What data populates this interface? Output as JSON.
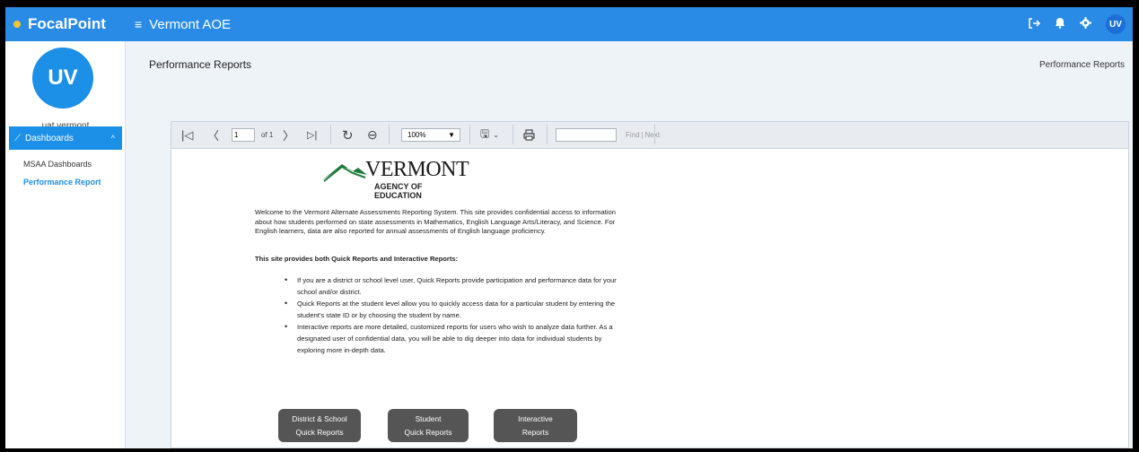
{
  "app": {
    "brand": "FocalPoint",
    "workspace": "Vermont AOE",
    "user_initials": "UV"
  },
  "sidebar": {
    "avatar_initials": "UV",
    "username": "uat vermont",
    "nav": {
      "dashboards": "Dashboards",
      "items": [
        {
          "label": "MSAA Dashboards"
        },
        {
          "label": "Performance Report"
        }
      ]
    }
  },
  "page": {
    "title": "Performance Reports",
    "breadcrumb": "Performance Reports"
  },
  "viewer": {
    "page_number": "1",
    "page_of": "of 1",
    "zoom": "100%",
    "find_placeholder": "",
    "find_label": "Find",
    "next_label": "Next"
  },
  "report": {
    "logo_name": "VERMONT",
    "logo_agency": "AGENCY OF EDUCATION",
    "intro": "Welcome to the Vermont Alternate Assessments Reporting System.  This site provides confidential access to information about how students performed on state assessments in Mathematics, English Language Arts/Literacy, and Science.  For English learners, data are also reported for annual assessments of English language proficiency.",
    "subhead": "This site provides both Quick Reports and Interactive Reports:",
    "bullets": [
      "If you are a district or school level user, Quick Reports provide participation and performance data for your school and/or district.",
      "Quick Reports at the student level allow you to quickly access data for a particular student by entering the student's state ID or by choosing the student by name.",
      "Interactive reports are more detailed, customized reports for users who wish to analyze data further. As a designated user of confidential data, you will be able to dig deeper into data for individual students by exploring more in-depth data."
    ],
    "buttons": [
      {
        "line1": "District & School",
        "line2": "Quick Reports"
      },
      {
        "line1": "Student",
        "line2": "Quick Reports"
      },
      {
        "line1": "Interactive",
        "line2": "Reports"
      }
    ]
  },
  "colors": {
    "primary": "#2a8be6",
    "button_dark": "#555555",
    "logo_green": "#1f7a3a"
  }
}
